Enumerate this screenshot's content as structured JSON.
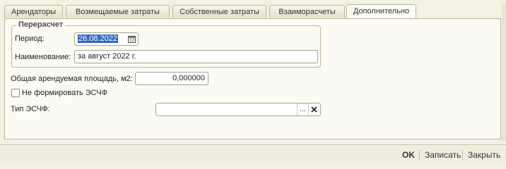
{
  "tabs": [
    {
      "label": "Арендаторы",
      "active": false
    },
    {
      "label": "Возмещаемые затраты",
      "active": false
    },
    {
      "label": "Собственные затраты",
      "active": false
    },
    {
      "label": "Взаиморасчеты",
      "active": false
    },
    {
      "label": "Дополнительно",
      "active": true
    }
  ],
  "recalc": {
    "title": "Перерасчет",
    "period_label": "Период:",
    "period_value": "26.08.2022",
    "name_label": "Наименование:",
    "name_value": "за август 2022 г."
  },
  "area": {
    "label": "Общая арендуемая площадь, м2:",
    "value": "0,000000"
  },
  "no_esf": {
    "label": "Не формировать ЭСЧФ",
    "checked": false
  },
  "esf_type": {
    "label": "Тип ЭСЧФ:",
    "value": "",
    "choose_label": "...",
    "clear_icon": "clear-x-icon"
  },
  "footer": {
    "ok_label": "OK",
    "save_label": "Записать",
    "close_label": "Закрыть"
  },
  "colors": {
    "background": "#f2f1e4",
    "panel": "#fbfbf4",
    "selection": "#3168c5",
    "border": "#b9b59a"
  }
}
